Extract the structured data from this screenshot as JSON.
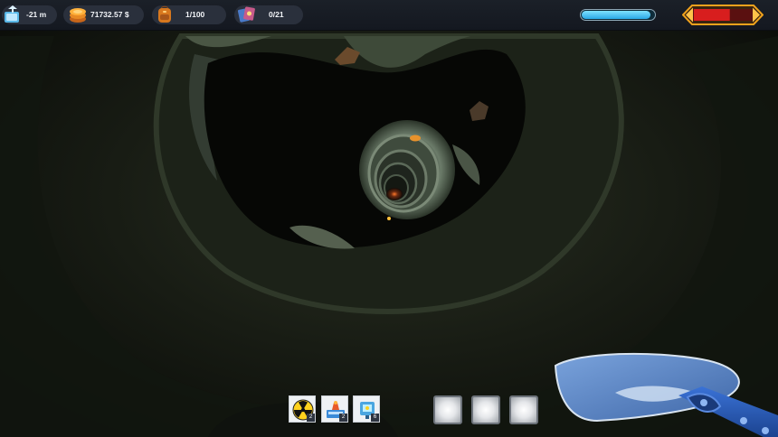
{
  "hud": {
    "depth": {
      "value": "-21 m",
      "icon": "depth-meter-icon"
    },
    "money": {
      "value": "71732.57 $",
      "icon": "coin-stack-icon"
    },
    "backpack": {
      "value": "1/100",
      "icon": "backpack-icon"
    },
    "cards": {
      "value": "0/21",
      "icon": "cards-icon"
    },
    "energy": {
      "level": 0.95,
      "color": "#3cc3f2"
    },
    "health": {
      "level": 0.62,
      "fill_color": "#d81e1e",
      "frame_color": "#f0a21c"
    }
  },
  "hotbar": {
    "items": [
      {
        "name": "radiation",
        "icon": "radiation-icon",
        "count": "2"
      },
      {
        "name": "booster",
        "icon": "booster-icon",
        "count": "2"
      },
      {
        "name": "gadget",
        "icon": "gadget-icon",
        "count": "6"
      }
    ],
    "empty_slots": 3
  },
  "tool": {
    "name": "shovel",
    "icon": "shovel-icon",
    "blade_color": "#5a86c8"
  }
}
